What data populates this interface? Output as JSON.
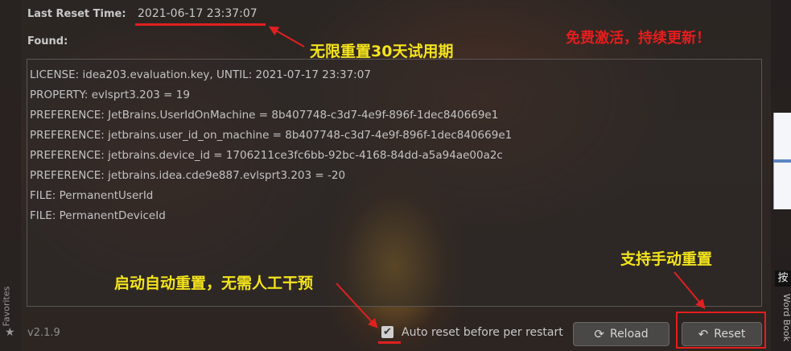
{
  "header": {
    "last_reset_label": "Last Reset Time:",
    "last_reset_value": "2021-06-17 23:37:07",
    "found_label": "Found:"
  },
  "found": [
    "LICENSE: idea203.evaluation.key, UNTIL: 2021-07-17 23:37:07",
    "PROPERTY: evlsprt3.203 = 19",
    "PREFERENCE: JetBrains.UserIdOnMachine = 8b407748-c3d7-4e9f-896f-1dec840669e1",
    "PREFERENCE: jetbrains.user_id_on_machine = 8b407748-c3d7-4e9f-896f-1dec840669e1",
    "PREFERENCE: jetbrains.device_id = 1706211ce3fc6bb-92bc-4168-84dd-a5a94ae00a2c",
    "PREFERENCE: jetbrains.idea.cde9e887.evlsprt3.203 = -20",
    "FILE: PermanentUserId",
    "FILE: PermanentDeviceId"
  ],
  "annotations": {
    "trial": "无限重置30天试用期",
    "free": "免费激活，持续更新！",
    "auto": "启动自动重置，无需人工干预",
    "manual": "支持手动重置"
  },
  "footer": {
    "version": "v2.1.9",
    "auto_reset_label": "Auto reset before per restart",
    "auto_reset_checked": true,
    "reload_label": "Reload",
    "reset_label": "Reset"
  },
  "side": {
    "favorites": "Favorites",
    "ime_char": "按",
    "word_book": "Word Book"
  },
  "colors": {
    "annotation_yellow": "#f3e31c",
    "annotation_red": "#e41d1d",
    "arrow_red": "#e02020"
  },
  "icons": {
    "reload": "reload-icon",
    "reset": "undo-icon",
    "favorites": "star-icon",
    "checkbox": "checkmark-icon"
  }
}
